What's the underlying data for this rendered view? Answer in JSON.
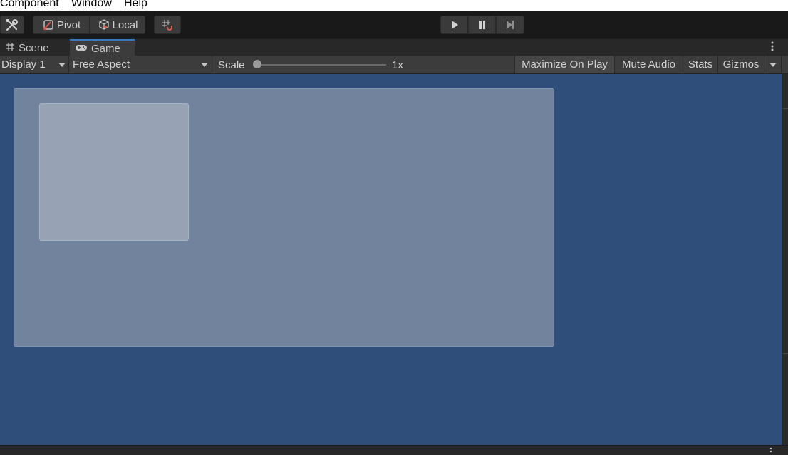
{
  "menu": {
    "items": [
      "Component",
      "Window",
      "Help"
    ]
  },
  "toolbar": {
    "pivot_label": "Pivot",
    "local_label": "Local"
  },
  "tabs": {
    "scene": "Scene",
    "game": "Game",
    "active": "game"
  },
  "game_toolbar": {
    "display": "Display 1",
    "aspect": "Free Aspect",
    "scale_label": "Scale",
    "scale_value": "1x",
    "scale_slider_fraction": 0,
    "maximize_on_play": "Maximize On Play",
    "mute_audio": "Mute Audio",
    "stats": "Stats",
    "gizmos": "Gizmos"
  },
  "colors": {
    "viewport_background": "#304e7a",
    "active_tab_accent": "#3a79bb"
  },
  "icons": {
    "tools": "wrench-icon",
    "pivot": "pivot-icon",
    "local": "cube-icon",
    "grid_snap": "grid-snap-icon",
    "play": "play-icon",
    "pause": "pause-icon",
    "step": "step-icon",
    "scene_tab": "grid-icon",
    "game_tab": "gamepad-icon",
    "more": "kebab-menu-icon"
  }
}
